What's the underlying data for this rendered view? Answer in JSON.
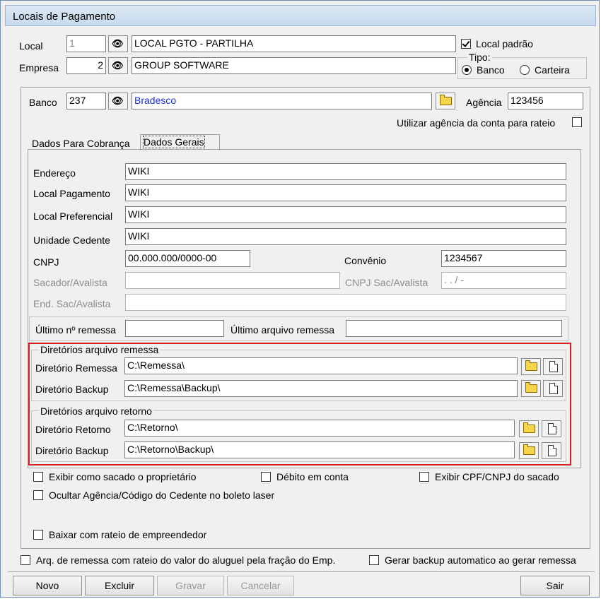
{
  "window": {
    "title": "Locais de Pagamento"
  },
  "top": {
    "local_label": "Local",
    "local_code": "1",
    "local_name": "LOCAL PGTO - PARTILHA",
    "local_padrao_label": "Local padrão",
    "local_padrao_checked": true,
    "empresa_label": "Empresa",
    "empresa_code": "2",
    "empresa_name": "GROUP SOFTWARE",
    "tipo_label": "Tipo:",
    "tipo_banco_label": "Banco",
    "tipo_carteira_label": "Carteira",
    "tipo_selected": "Banco"
  },
  "banco": {
    "banco_label": "Banco",
    "banco_code": "237",
    "banco_name": "Bradesco",
    "agencia_label": "Agência",
    "agencia_value": "123456",
    "utilizar_agencia_label": "Utilizar agência da conta para rateio"
  },
  "tabs": [
    {
      "label": "Dados Para Cobrança"
    },
    {
      "label": "Dados Gerais"
    }
  ],
  "active_tab": "Dados Gerais",
  "dados": {
    "endereco_label": "Endereço",
    "endereco_value": "WIKI",
    "local_pagamento_label": "Local Pagamento",
    "local_pagamento_value": "WIKI",
    "local_preferencial_label": "Local Preferencial",
    "local_preferencial_value": "WIKI",
    "unidade_cedente_label": "Unidade Cedente",
    "unidade_cedente_value": "WIKI",
    "cnpj_label": "CNPJ",
    "cnpj_value": "00.000.000/0000-00",
    "convenio_label": "Convênio",
    "convenio_value": "1234567",
    "sacador_label": "Sacador/Avalista",
    "cnpj_sac_label": "CNPJ Sac/Avalista",
    "cnpj_sac_mask": " .   .   /   -",
    "end_sac_label": "End. Sac/Avalista",
    "ultimo_remessa_label": "Último nº remessa",
    "ultimo_arquivo_label": "Último arquivo remessa"
  },
  "remessa": {
    "group_title": "Diretórios arquivo remessa",
    "dir_remessa_label": "Diretório Remessa",
    "dir_remessa_value": "C:\\Remessa\\",
    "dir_backup_label": "Diretório Backup",
    "dir_backup_value": "C:\\Remessa\\Backup\\"
  },
  "retorno": {
    "group_title": "Diretórios arquivo retorno",
    "dir_retorno_label": "Diretório Retorno",
    "dir_retorno_value": "C:\\Retorno\\",
    "dir_backup_label": "Diretório Backup",
    "dir_backup_value": "C:\\Retorno\\Backup\\"
  },
  "options": {
    "exibir_sacado_label": "Exibir como sacado o proprietário",
    "debito_conta_label": "Débito em conta",
    "exibir_cpf_label": "Exibir CPF/CNPJ do sacado",
    "ocultar_agencia_label": "Ocultar Agência/Código do Cedente no boleto laser",
    "baixar_rateio_label": "Baixar com rateio de empreendedor",
    "arq_remessa_label": "Arq. de remessa com rateio do valor do aluguel pela fração do Emp.",
    "gerar_backup_label": "Gerar backup automatico ao gerar remessa"
  },
  "buttons": {
    "novo": "Novo",
    "excluir": "Excluir",
    "gravar": "Gravar",
    "cancelar": "Cancelar",
    "sair": "Sair"
  },
  "colors": {
    "highlight": "#d42020",
    "link_blue": "#1a2fd6"
  }
}
